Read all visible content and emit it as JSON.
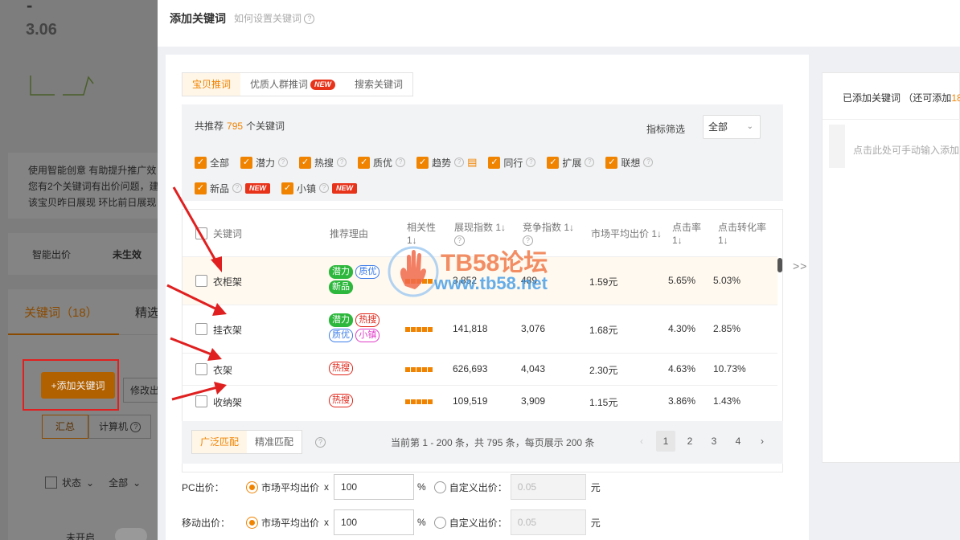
{
  "background": {
    "top_value": "3.06",
    "dash": "-",
    "notice_lines": [
      "使用智能创意  有助提升推广效",
      "您有2个关键词有出价问题，建",
      "该宝贝昨日展现  环比前日展现"
    ],
    "smart_bid_label": "智能出价",
    "smart_bid_status": "未生效",
    "tab_keywords": "关键词（18）",
    "tab_other": "精选",
    "add_keyword_button": "+添加关键词",
    "modify_button": "修改出",
    "sub_tabs": [
      "汇总",
      "计算机"
    ],
    "status_label": "状态",
    "all_label": "全部",
    "off_label": "未开启"
  },
  "panel": {
    "title": "添加关键词",
    "help_link": "如何设置关键词"
  },
  "tabs": [
    {
      "label": "宝贝推词",
      "active": true,
      "new": false
    },
    {
      "label": "优质人群推词",
      "active": false,
      "new": true
    },
    {
      "label": "搜索关键词",
      "active": false,
      "new": false
    }
  ],
  "new_badge": "NEW",
  "filter": {
    "rec_prefix": "共推荐",
    "rec_count": "795",
    "rec_suffix": "个关键词",
    "metric_label": "指标筛选",
    "metric_value": "全部",
    "checks_row1": [
      "全部",
      "潜力",
      "热搜",
      "质优",
      "趋势",
      "同行",
      "扩展",
      "联想"
    ],
    "checks_row2": [
      "新品",
      "小镇"
    ]
  },
  "table": {
    "headers": [
      "关键词",
      "推荐理由",
      "相关性",
      "展现指数",
      "竞争指数",
      "市场平均出价",
      "点击率",
      "点击转化率"
    ],
    "rows": [
      {
        "keyword": "衣柜架",
        "tags": [
          "潜力",
          "质优",
          "新品"
        ],
        "impressions": "3,852",
        "competition": "489",
        "avg_bid": "1.59元",
        "ctr": "5.65%",
        "cvr": "5.03%"
      },
      {
        "keyword": "挂衣架",
        "tags": [
          "潜力",
          "热搜",
          "质优",
          "小镇"
        ],
        "impressions": "141,818",
        "competition": "3,076",
        "avg_bid": "1.68元",
        "ctr": "4.30%",
        "cvr": "2.85%"
      },
      {
        "keyword": "衣架",
        "tags": [
          "热搜"
        ],
        "impressions": "626,693",
        "competition": "4,043",
        "avg_bid": "2.30元",
        "ctr": "4.63%",
        "cvr": "10.73%"
      },
      {
        "keyword": "收纳架",
        "tags": [
          "热搜"
        ],
        "impressions": "109,519",
        "competition": "3,909",
        "avg_bid": "1.15元",
        "ctr": "3.86%",
        "cvr": "1.43%"
      }
    ]
  },
  "bottom": {
    "match_broad": "广泛匹配",
    "match_exact": "精准匹配",
    "page_info": "当前第 1 - 200 条，共 795 条，每页展示 200 条",
    "pages": [
      "1",
      "2",
      "3",
      "4"
    ]
  },
  "pricing": {
    "pc_label": "PC出价：",
    "mobile_label": "移动出价：",
    "market_avg": "市场平均出价",
    "times": "x",
    "pc_value": "100",
    "mobile_value": "100",
    "percent": "%",
    "custom": "自定义出价：",
    "custom_placeholder": "0.05",
    "yuan": "元"
  },
  "right_panel": {
    "title": "已添加关键词 （还可添加",
    "remaining": "18",
    "hint": "点击此处可手动输入添加"
  },
  "watermark": {
    "brand": "TB58论坛",
    "url": "www.tb58.net"
  },
  "colors": {
    "accent": "#f08300",
    "new_badge": "#e8331b",
    "annotation": "#e02020"
  }
}
